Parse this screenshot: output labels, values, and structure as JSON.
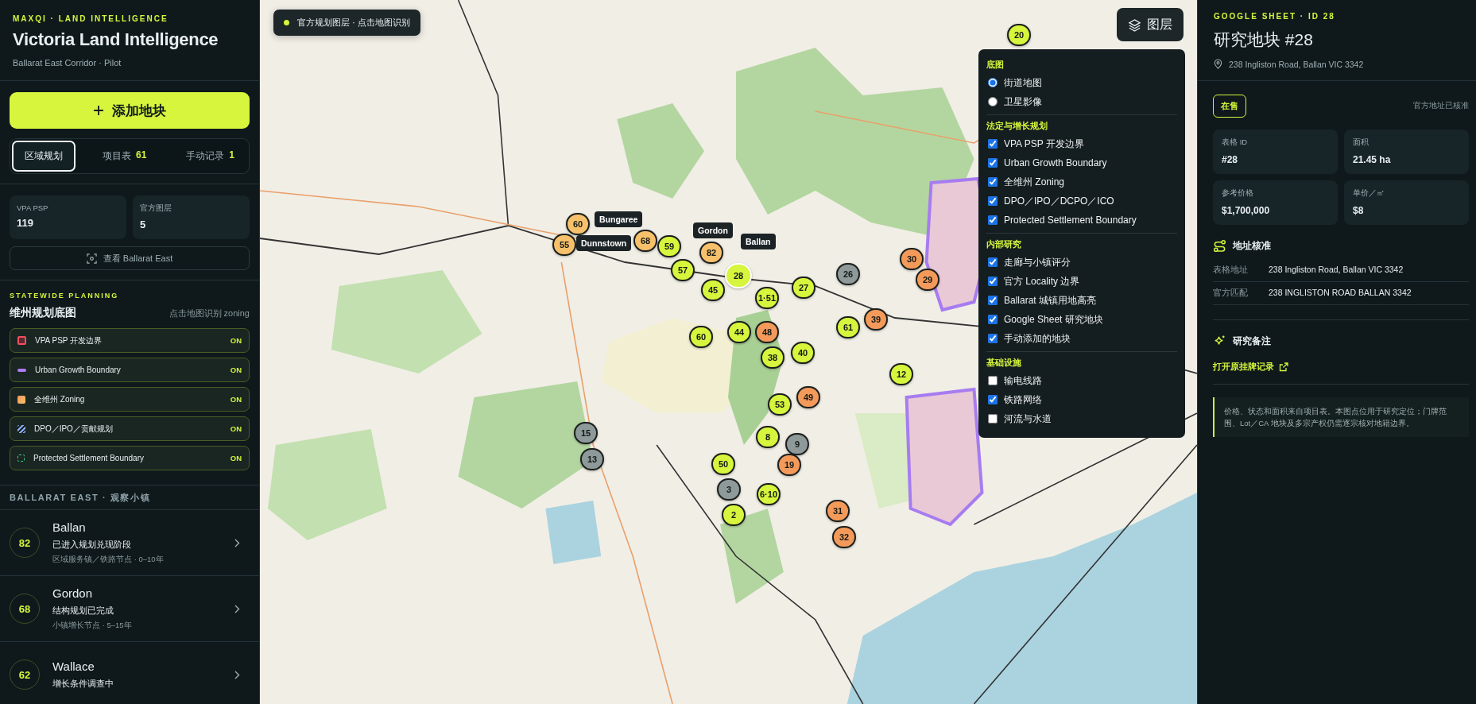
{
  "sidebar": {
    "eyebrow": "MAXQI · LAND INTELLIGENCE",
    "title": "Victoria Land Intelligence",
    "subtitle": "Ballarat East Corridor · Pilot",
    "add_button": "添加地块",
    "tabs": [
      {
        "label": "区域规划",
        "selected": true
      },
      {
        "label": "项目表",
        "count": "61",
        "selected": false
      },
      {
        "label": "手动记录",
        "count": "1",
        "selected": false
      }
    ],
    "stats": [
      {
        "label": "VPA PSP",
        "value": "119"
      },
      {
        "label": "官方图层",
        "value": "5"
      }
    ],
    "view_button": "查看 Ballarat East",
    "planning": {
      "eyebrow": "STATEWIDE PLANNING",
      "title": "维州规划底图",
      "hint": "点击地图识别 zoning",
      "layers": [
        {
          "kind": "boundary",
          "label": "VPA PSP 开发边界",
          "badge": "ON",
          "on": true
        },
        {
          "kind": "line",
          "label": "Urban Growth Boundary",
          "badge": "ON",
          "on": true
        },
        {
          "kind": "fill",
          "label": "全维州 Zoning",
          "badge": "ON",
          "on": true
        },
        {
          "kind": "hatch",
          "label": "DPO／IPO／贡献规划",
          "badge": "ON",
          "on": true
        },
        {
          "kind": "dashed",
          "label": "Protected Settlement Boundary",
          "badge": "ON",
          "on": true
        }
      ]
    },
    "towns_heading": "BALLARAT EAST · 观察小镇",
    "towns": [
      {
        "score": "82",
        "name": "Ballan",
        "status": "已进入规划兑现阶段",
        "meta": "区域服务镇／铁路节点 · 0–10年"
      },
      {
        "score": "68",
        "name": "Gordon",
        "status": "结构规划已完成",
        "meta": "小镇增长节点 · 5–15年"
      },
      {
        "score": "62",
        "name": "Wallace",
        "status": "增长条件调查中"
      }
    ]
  },
  "map": {
    "chip": "官方规划图层 · 点击地图识别",
    "layers_button": "图层",
    "markers": [
      {
        "label": "20",
        "color": "#d6f53c",
        "selected": false
      },
      {
        "label": "60",
        "color": "#f7c06a",
        "selected": false
      },
      {
        "label": "55",
        "color": "#f7c06a",
        "selected": false
      },
      {
        "label": "68",
        "color": "#f7c06a",
        "selected": false
      },
      {
        "label": "59",
        "color": "#d6f53c",
        "selected": false
      },
      {
        "label": "57",
        "color": "#d6f53c",
        "selected": false
      },
      {
        "label": "82",
        "color": "#f7c06a",
        "selected": false
      },
      {
        "label": "45",
        "color": "#d6f53c",
        "selected": false
      },
      {
        "label": "1·51",
        "color": "#d6f53c",
        "selected": false
      },
      {
        "label": "27",
        "color": "#d6f53c",
        "selected": false
      },
      {
        "label": "26",
        "color": "#8e9a9a",
        "selected": false
      },
      {
        "label": "30",
        "color": "#f39a5a",
        "selected": false
      },
      {
        "label": "29",
        "color": "#f39a5a",
        "selected": false
      },
      {
        "label": "60",
        "color": "#d6f53c",
        "selected": false
      },
      {
        "label": "44",
        "color": "#d6f53c",
        "selected": false
      },
      {
        "label": "48",
        "color": "#f39a5a",
        "selected": false
      },
      {
        "label": "38",
        "color": "#d6f53c",
        "selected": false
      },
      {
        "label": "40",
        "color": "#d6f53c",
        "selected": false
      },
      {
        "label": "61",
        "color": "#d6f53c",
        "selected": false
      },
      {
        "label": "39",
        "color": "#f39a5a",
        "selected": false
      },
      {
        "label": "12",
        "color": "#d6f53c",
        "selected": false
      },
      {
        "label": "49",
        "color": "#f39a5a",
        "selected": false
      },
      {
        "label": "53",
        "color": "#d6f53c",
        "selected": false
      },
      {
        "label": "15",
        "color": "#8e9a9a",
        "selected": false
      },
      {
        "label": "13",
        "color": "#8e9a9a",
        "selected": false
      },
      {
        "label": "8",
        "color": "#d6f53c",
        "selected": false
      },
      {
        "label": "9",
        "color": "#8e9a9a",
        "selected": false
      },
      {
        "label": "50",
        "color": "#d6f53c",
        "selected": false
      },
      {
        "label": "19",
        "color": "#f39a5a",
        "selected": false
      },
      {
        "label": "3",
        "color": "#8e9a9a",
        "selected": false
      },
      {
        "label": "6·10",
        "color": "#d6f53c",
        "selected": false
      },
      {
        "label": "2",
        "color": "#d6f53c",
        "selected": false
      },
      {
        "label": "31",
        "color": "#f39a5a",
        "selected": false
      },
      {
        "label": "32",
        "color": "#f39a5a",
        "selected": false
      },
      {
        "label": "28",
        "color": "#d6f53c",
        "selected": true
      }
    ],
    "town_labels": [
      "Bungaree",
      "Dunnstown",
      "Gordon",
      "Ballan"
    ],
    "layer_menu": [
      {
        "kind": "radio",
        "title": "底图",
        "items": [
          {
            "label": "街道地图",
            "selected": true
          },
          {
            "label": "卫星影像",
            "selected": false
          }
        ]
      },
      {
        "kind": "checkbox",
        "title": "法定与增长规划",
        "items": [
          {
            "label": "VPA PSP 开发边界",
            "checked": true
          },
          {
            "label": "Urban Growth Boundary",
            "checked": true
          },
          {
            "label": "全维州 Zoning",
            "checked": true
          },
          {
            "label": "DPO／IPO／DCPO／ICO",
            "checked": true
          },
          {
            "label": "Protected Settlement Boundary",
            "checked": true
          }
        ]
      },
      {
        "kind": "checkbox",
        "title": "内部研究",
        "items": [
          {
            "label": "走廊与小镇评分",
            "checked": true
          },
          {
            "label": "官方 Locality 边界",
            "checked": true
          },
          {
            "label": "Ballarat 城镇用地高亮",
            "checked": true
          },
          {
            "label": "Google Sheet 研究地块",
            "checked": true
          },
          {
            "label": "手动添加的地块",
            "checked": true
          }
        ]
      },
      {
        "kind": "checkbox",
        "title": "基础设施",
        "items": [
          {
            "label": "输电线路",
            "checked": false
          },
          {
            "label": "铁路网络",
            "checked": true
          },
          {
            "label": "河流与水道",
            "checked": false
          }
        ]
      }
    ]
  },
  "detail": {
    "eyebrow": "GOOGLE SHEET · ID 28",
    "title": "研究地块 #28",
    "address": "238 Ingliston Road, Ballan VIC 3342",
    "status_badge": "在售",
    "verified": "官方地址已核准",
    "facts": [
      {
        "label": "表格 ID",
        "value": "#28"
      },
      {
        "label": "面积",
        "value": "21.45 ha"
      },
      {
        "label": "参考价格",
        "value": "$1,700,000"
      },
      {
        "label": "单价／㎡",
        "value": "$8"
      }
    ],
    "address_check": {
      "title": "地址核准",
      "rows": [
        {
          "label": "表格地址",
          "value": "238 Ingliston Road, Ballan VIC 3342"
        },
        {
          "label": "官方匹配",
          "value": "238 INGLISTON ROAD BALLAN 3342"
        }
      ]
    },
    "notes": {
      "title": "研究备注",
      "link": "打开原挂牌记录",
      "note": "价格、状态和面积来自项目表。本图点位用于研究定位；门牌范围、Lot／CA 地块及多宗产权仍需逐宗核对地籍边界。"
    }
  }
}
